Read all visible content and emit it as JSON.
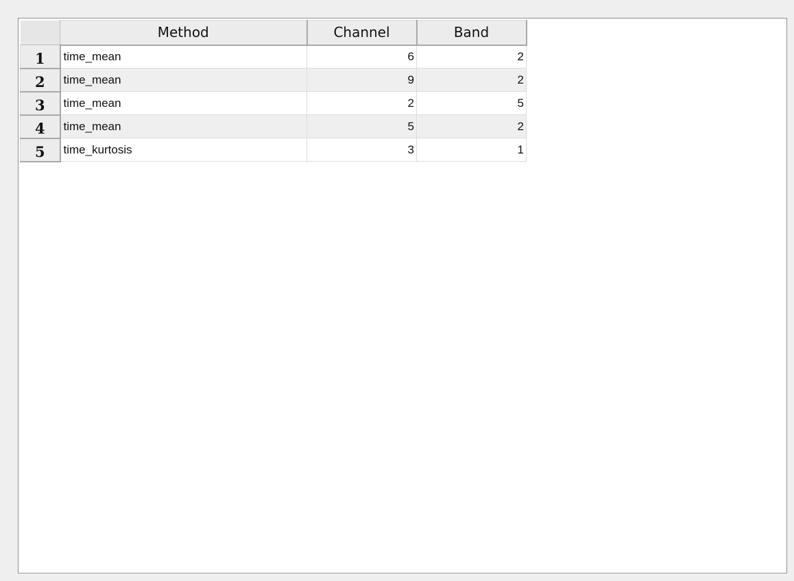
{
  "table": {
    "columns": [
      "Method",
      "Channel",
      "Band"
    ],
    "rows": [
      {
        "index": "1",
        "method": "time_mean",
        "channel": "6",
        "band": "2"
      },
      {
        "index": "2",
        "method": "time_mean",
        "channel": "9",
        "band": "2"
      },
      {
        "index": "3",
        "method": "time_mean",
        "channel": "2",
        "band": "5"
      },
      {
        "index": "4",
        "method": "time_mean",
        "channel": "5",
        "band": "2"
      },
      {
        "index": "5",
        "method": "time_kurtosis",
        "channel": "3",
        "band": "1"
      }
    ]
  },
  "colors": {
    "window_bg": "#efefef",
    "table_bg": "#ffffff",
    "header_bg": "#ececec",
    "stripe_bg": "#efefef"
  }
}
